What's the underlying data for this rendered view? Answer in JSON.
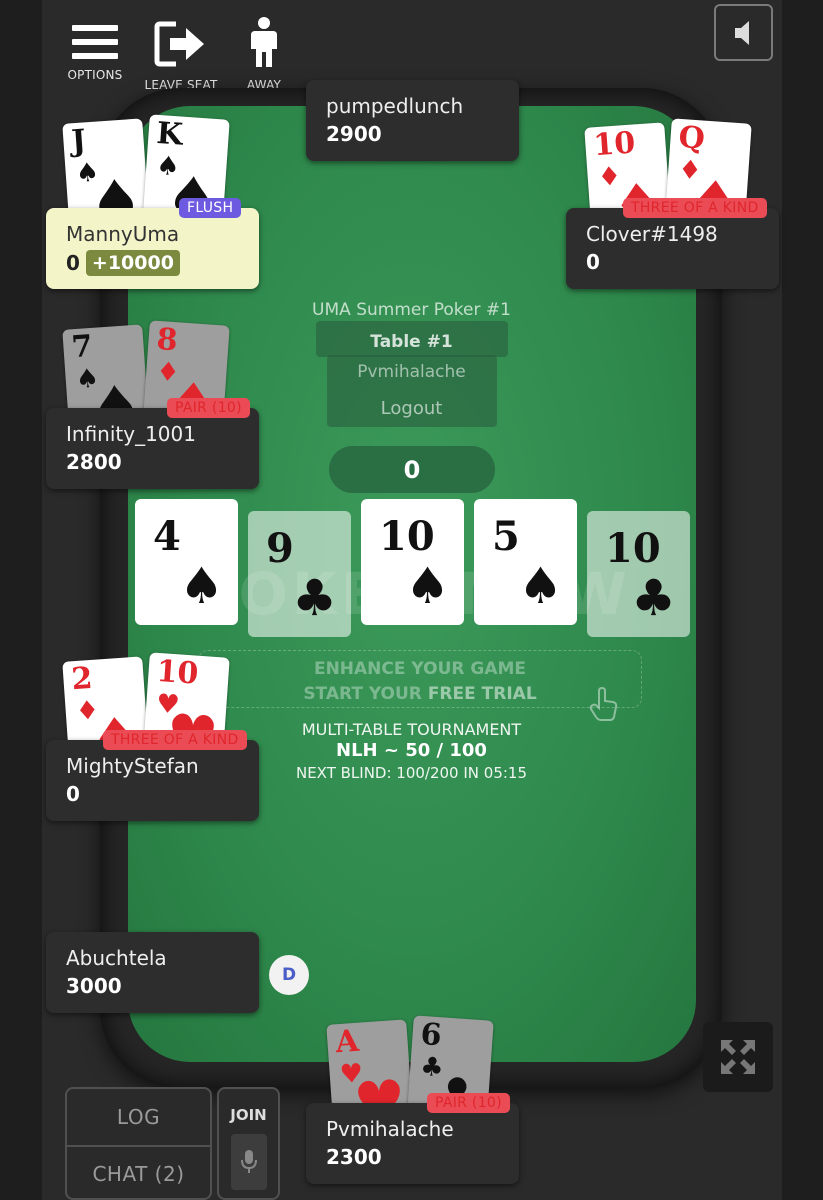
{
  "controls": {
    "options_label": "OPTIONS",
    "leave_seat_label": "LEAVE SEAT",
    "away_label": "AWAY"
  },
  "table_info": {
    "tournament_name": "UMA Summer Poker #1",
    "table_name": "Table #1",
    "overlay_line": "Pvmihalache",
    "logout_label": "Logout",
    "pot": "0",
    "enhance_line1": "ENHANCE YOUR GAME",
    "enhance_line2_prefix": "START YOUR ",
    "enhance_line2_bold": "FREE TRIAL",
    "game_type": "MULTI-TABLE TOURNAMENT",
    "stakes": "NLH ~ 50 / 100",
    "next_blind": "NEXT BLIND: 100/200 IN 05:15",
    "watermark": "POKER NOW"
  },
  "players": {
    "pumpedlunch": {
      "name": "pumpedlunch",
      "chips": "2900"
    },
    "mannyuma": {
      "name": "MannyUma",
      "chips": "0",
      "win": "+10000",
      "hand": "FLUSH",
      "cards": [
        {
          "rank": "J",
          "suit": "♠",
          "color": "black"
        },
        {
          "rank": "K",
          "suit": "♠",
          "color": "black"
        }
      ]
    },
    "clover": {
      "name": "Clover#1498",
      "chips": "0",
      "hand": "THREE OF A KIND",
      "cards": [
        {
          "rank": "10",
          "suit": "♦",
          "color": "red"
        },
        {
          "rank": "Q",
          "suit": "♦",
          "color": "red"
        }
      ]
    },
    "infinity": {
      "name": "Infinity_1001",
      "chips": "2800",
      "hand": "PAIR (10)",
      "cards": [
        {
          "rank": "7",
          "suit": "♠",
          "color": "black"
        },
        {
          "rank": "8",
          "suit": "♦",
          "color": "red"
        }
      ]
    },
    "mightystefan": {
      "name": "MightyStefan",
      "chips": "0",
      "hand": "THREE OF A KIND",
      "cards": [
        {
          "rank": "2",
          "suit": "♦",
          "color": "red"
        },
        {
          "rank": "10",
          "suit": "♥",
          "color": "red"
        }
      ]
    },
    "abuchtela": {
      "name": "Abuchtela",
      "chips": "3000"
    },
    "pvmihalache": {
      "name": "Pvmihalache",
      "chips": "2300",
      "hand": "PAIR (10)",
      "cards": [
        {
          "rank": "A",
          "suit": "♥",
          "color": "red"
        },
        {
          "rank": "6",
          "suit": "♣",
          "color": "black"
        }
      ]
    }
  },
  "board": [
    {
      "rank": "4",
      "suit": "♠",
      "highlight": true
    },
    {
      "rank": "9",
      "suit": "♣",
      "highlight": false
    },
    {
      "rank": "10",
      "suit": "♠",
      "highlight": true
    },
    {
      "rank": "5",
      "suit": "♠",
      "highlight": true
    },
    {
      "rank": "10",
      "suit": "♣",
      "highlight": false
    }
  ],
  "dealer_label": "D",
  "bottom": {
    "log_label": "LOG",
    "chat_label": "CHAT (2)",
    "join_label": "JOIN"
  },
  "icons": {
    "menu": "hamburger-icon",
    "leave": "exit-arrow-icon",
    "away": "person-icon",
    "sound": "speaker-icon",
    "expand": "fullscreen-icon",
    "mic": "microphone-icon",
    "hand": "pointer-hand-icon"
  },
  "colors": {
    "felt": "#2f8a4d",
    "badge_red": "#ea4b55",
    "badge_purple": "#6c5be0",
    "winner_bg": "#f3f5c8"
  }
}
